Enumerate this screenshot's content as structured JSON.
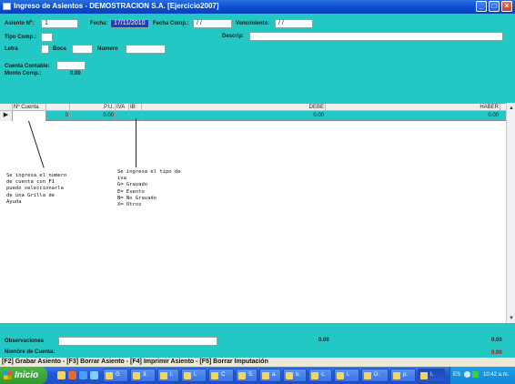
{
  "window": {
    "title": "Ingreso de Asientos - DEMOSTRACION S.A.  [Ejercicio2007]"
  },
  "header": {
    "asiento_label": "Asiento Nº:",
    "asiento_value": "1",
    "fecha_label": "Fecha:",
    "fecha_value": "17/11/2010",
    "fecha_comp_label": "Fecha Comp.:",
    "fecha_comp_value": "/ /",
    "vencimiento_label": "Vencimiento:",
    "vencimiento_value": "/ /",
    "tipo_comp_label": "Tipo Comp.:",
    "tipo_comp_value": "",
    "descrip_label": "Descrip:",
    "descrip_value": "",
    "letra_label": "Letra",
    "letra_value": "",
    "boca_label": "Boca",
    "boca_value": "",
    "numero_label": "Numero",
    "numero_value": "",
    "cuenta_contable_label": "Cuenta Contable:",
    "cuenta_contable_value": "",
    "monto_comp_label": "Monto Comp.:",
    "monto_comp_value": "0.00"
  },
  "grid": {
    "columns": [
      "Nº Cuenta",
      "P.U.",
      "IVA",
      "IB",
      "DEBE",
      "HABER"
    ],
    "rows": [
      {
        "cuenta": "",
        "cant": "0",
        "pu": "0.00",
        "iva": "",
        "ib": "",
        "debe": "0.00",
        "haber": "0.00"
      }
    ]
  },
  "notes": {
    "cuenta": "Se ingresa el numero\nde cuenta con F1\npuedo seleccionarla\nde una Grilla de\nAyuda",
    "iva": "Se ingresa el tipo de\niva\nG= Gravado\nE= Exento\nN= No Gravado\nX= Otros"
  },
  "footer": {
    "observaciones_label": "Observaciones",
    "observaciones_value": "",
    "nombre_cuenta_label": "Nombre de Cuenta:",
    "total_debe": "0.00",
    "total_haber": "0.00",
    "diferencia": "0.00"
  },
  "function_keys": "[F2] Grabar Asiento - [F3] Borrar Asiento - [F4] Imprimir Asiento - [F5] Borrar Imputación",
  "taskbar": {
    "start_label": "Inicio",
    "tasks": [
      "G",
      "3.",
      "I.",
      "I.",
      "C",
      "S.",
      "a.",
      "b.",
      "c.",
      "I.",
      "D.",
      "p.",
      "I."
    ],
    "language": "ES",
    "clock": "10:42 a.m."
  },
  "colors": {
    "form_background": "#23c8c4",
    "title_bar": "#0a4fd0",
    "date_highlight": "#1f3fb8",
    "haber_total": "#d00000"
  }
}
